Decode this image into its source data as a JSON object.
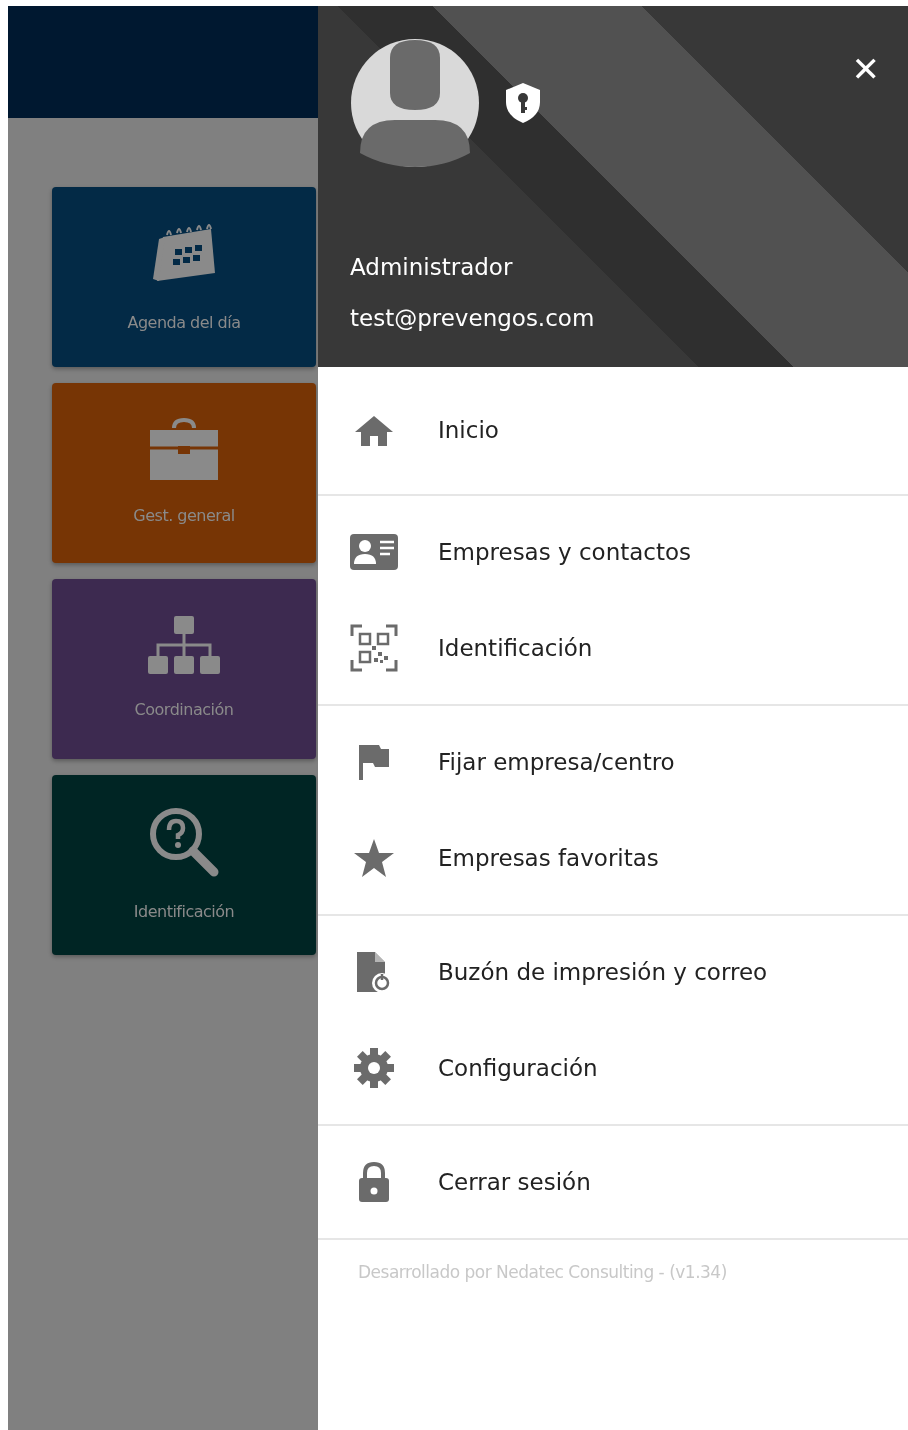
{
  "tiles": [
    {
      "label": "Agenda del día",
      "color": "#032a46"
    },
    {
      "label": "Gest. general",
      "color": "#773505"
    },
    {
      "label": "Coordinación",
      "color": "#3d2a50"
    },
    {
      "label": "Identificación",
      "color": "#002524"
    }
  ],
  "drawer": {
    "user": {
      "name": "Administrador",
      "email": "test@prevengos.com"
    },
    "close": "✕",
    "groups": [
      [
        {
          "label": "Inicio"
        }
      ],
      [
        {
          "label": "Empresas y contactos"
        },
        {
          "label": "Identificación"
        }
      ],
      [
        {
          "label": "Fijar empresa/centro"
        },
        {
          "label": "Empresas favoritas"
        }
      ],
      [
        {
          "label": "Buzón de impresión y correo"
        },
        {
          "label": "Configuración"
        }
      ],
      [
        {
          "label": "Cerrar sesión"
        }
      ]
    ],
    "footer": "Desarrollado por Nedatec Consulting - (v1.34)"
  }
}
